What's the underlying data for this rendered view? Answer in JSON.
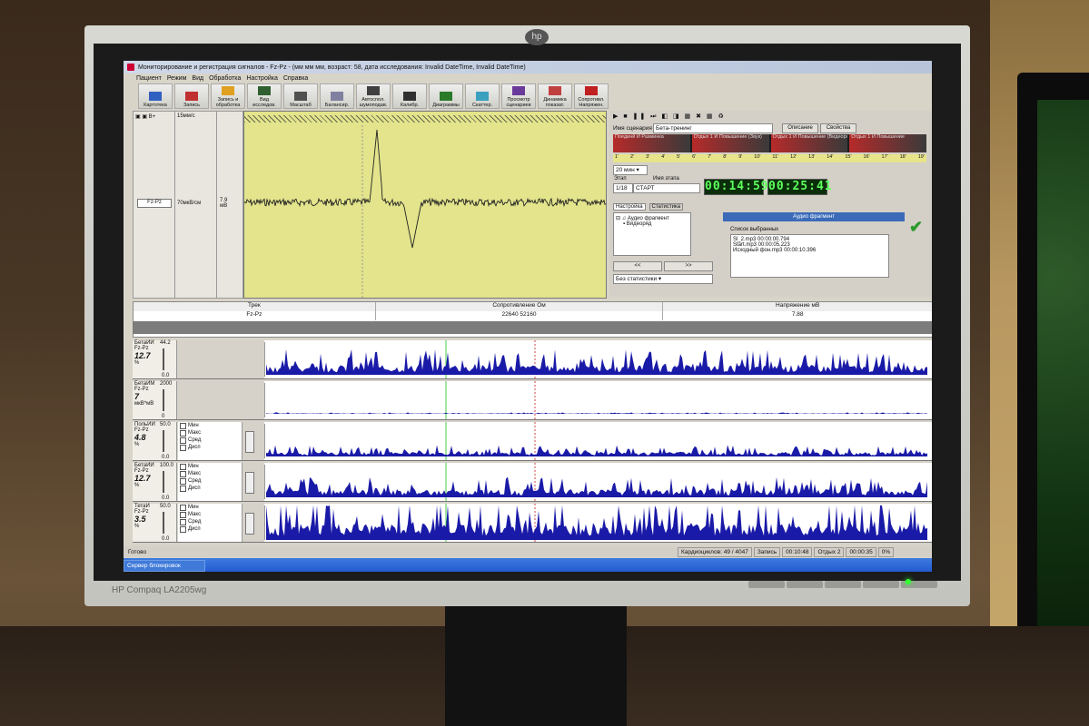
{
  "window": {
    "title": "Мониторирование и регистрация сигналов - Fz-Pz - (мм мм мм, возраст: 58, дата исследования: Invalid DateTime, Invalid DateTime)"
  },
  "menu": [
    "Пациент",
    "Режим",
    "Вид",
    "Обработка",
    "Настройка",
    "Справка"
  ],
  "toolbar": [
    {
      "label": "Картотека"
    },
    {
      "label": "Запись"
    },
    {
      "label": "Запись и обработка"
    },
    {
      "label": "Вид исследов."
    },
    {
      "label": "Масштаб"
    },
    {
      "label": "Балансир."
    },
    {
      "label": "Автоспол. шумоподав."
    },
    {
      "label": "Калибр."
    },
    {
      "label": "Диаграммы"
    },
    {
      "label": "Скаттер."
    },
    {
      "label": "Просмотр сценариев"
    },
    {
      "label": "Динамика показат."
    },
    {
      "label": "Сопротивл. Напряжен."
    }
  ],
  "left_panel": {
    "speed": "15мм/с",
    "channel": "Fz-Pz",
    "gain": "70мкВ/см",
    "value": "7.9",
    "unit": "мВ"
  },
  "scenario": {
    "name_label": "Имя сценария",
    "name_value": "Бета-тренинг",
    "description_button": "Описание",
    "properties_button": "Свойства",
    "tracks": [
      "Поединй И Разминка",
      "Отдых 1 И Повышение (Звук)",
      "Отдых 1 И Повышение (Видеоряд)",
      "Отдых 1 И Повышение"
    ],
    "ruler": [
      "1'",
      "2'",
      "3'",
      "4'",
      "5'",
      "6'",
      "7'",
      "8'",
      "9'",
      "10'",
      "11'",
      "12'",
      "13'",
      "14'",
      "15'",
      "16'",
      "17'",
      "18'",
      "19'"
    ],
    "duration": "20 мин",
    "stage_label": "Этап",
    "stage_value": "1/18",
    "stage_name_label": "Имя этапа",
    "stage_name_value": "СТАРТ",
    "timer_elapsed": "00:14:59",
    "timer_total": "00:25:41",
    "tab_settings": "Настройка",
    "tab_stats": "Статистика",
    "tree_audio": "Аудио фрагмент",
    "tree_video": "Видеоряд",
    "prev_button": "<<",
    "next_button": ">>",
    "stats_select": "Без статистики",
    "fragment_header": "Аудио фрагмент",
    "selected_list_label": "Список выбранных",
    "selected_items": [
      "Sl_2.mp3  00:00:00.794",
      "Start.mp3  00:00:05.223",
      "Исходный фон.mp3  00:00:10.396"
    ]
  },
  "table": {
    "headers": [
      "Трек",
      "Сопротивление Ом",
      "Напряжение мВ"
    ],
    "row": {
      "track": "Fz-Pz",
      "resistance": "22640    52160",
      "voltage": "7.88"
    }
  },
  "channels": [
    {
      "name": "БетаИИ",
      "lead": "Fz-Pz",
      "top": "44.2",
      "value": "12.7",
      "bottom": "0.0",
      "unit": "%",
      "has_opts": false
    },
    {
      "name": "БетаИМ",
      "lead": "Fz-Pz",
      "top": "2000",
      "value": "7",
      "bottom": "0",
      "unit": "мкВ*мВ",
      "has_opts": false
    },
    {
      "name": "ПольИИ",
      "lead": "Fz-Pz",
      "top": "50.0",
      "value": "4.8",
      "bottom": "0.0",
      "unit": "%",
      "has_opts": true
    },
    {
      "name": "БетаИИ",
      "lead": "Fz-Pz",
      "top": "100.0",
      "value": "12.7",
      "bottom": "0.0",
      "unit": "%",
      "has_opts": true
    },
    {
      "name": "ТетаИ",
      "lead": "Fz-Pz",
      "top": "50.0",
      "value": "3.5",
      "bottom": "0.0",
      "unit": "%",
      "has_opts": true
    }
  ],
  "opts": [
    "Мин",
    "Макс",
    "Сред",
    "Дисп"
  ],
  "status": {
    "ready": "Готово",
    "cardio": "Кардиоциклов: 49 / 4047",
    "record_label": "Запись",
    "record_time": "00:10:48",
    "stage_label": "Отдых 2",
    "stage_time": "00:00:35",
    "percent": "0%"
  },
  "taskbar": {
    "task": "Сервер блокировок"
  },
  "monitor": {
    "model": "HP Compaq LA2205wg",
    "logo": "hp"
  },
  "colors": {
    "signal": "#1a1aa8",
    "plot_bg": "#e3e48c",
    "timer": "#5dff5d"
  }
}
